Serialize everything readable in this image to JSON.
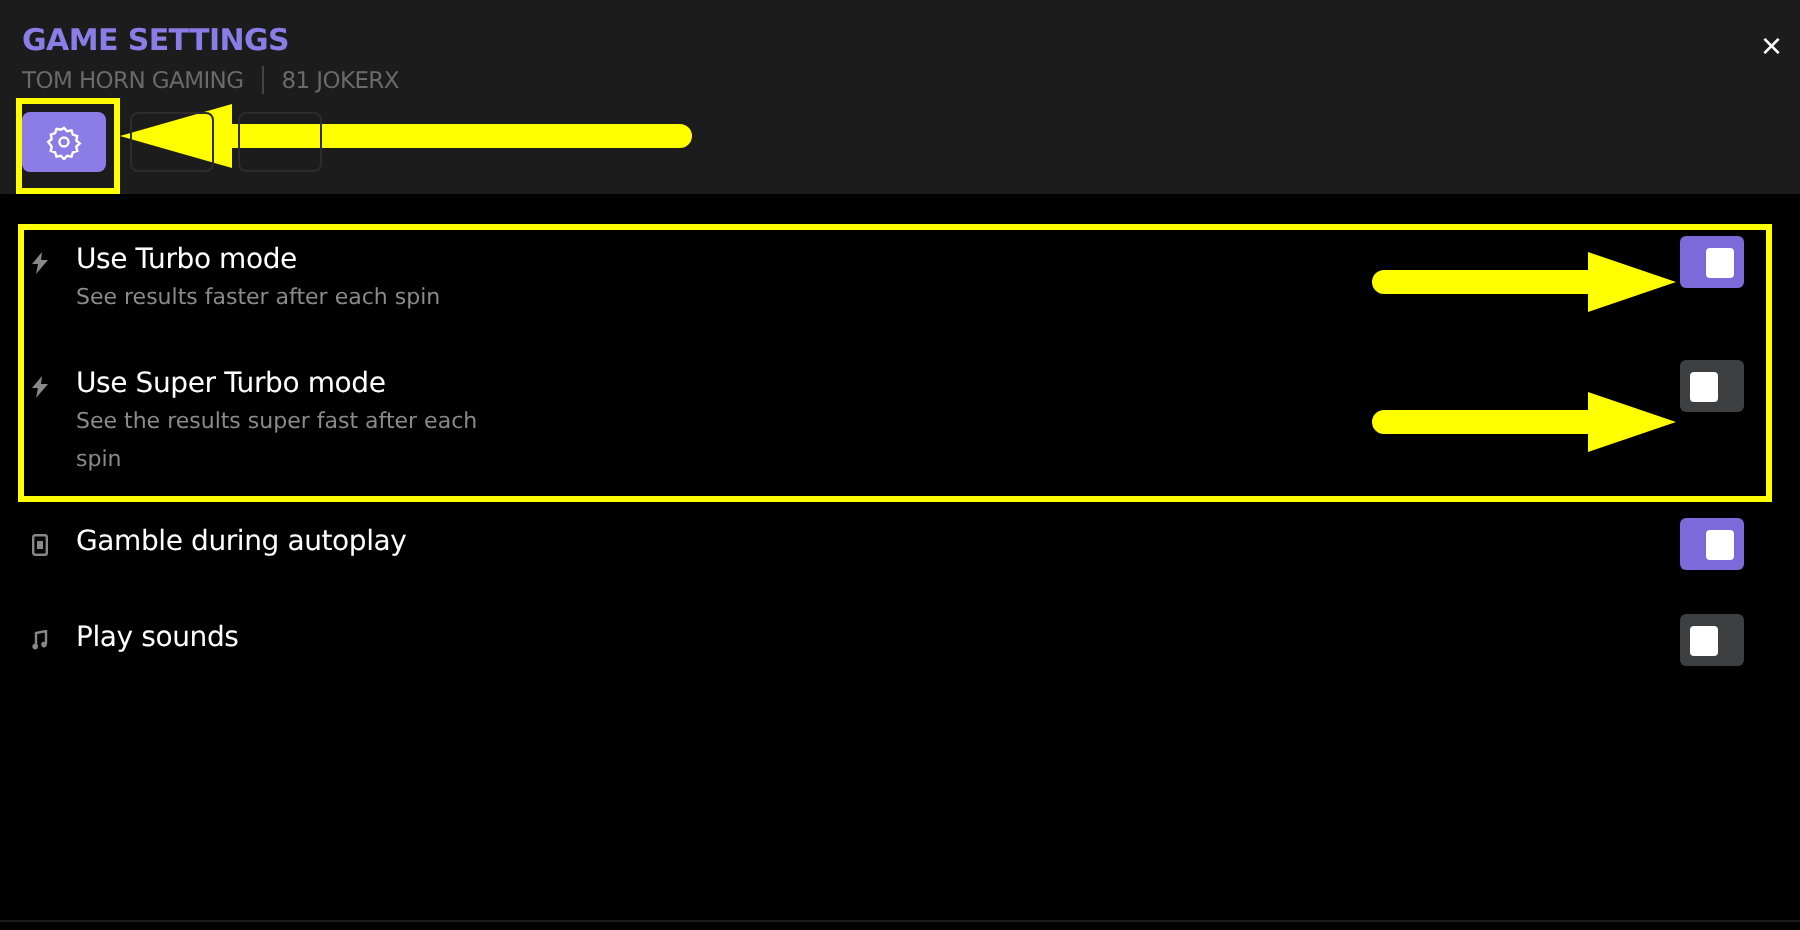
{
  "header": {
    "title": "GAME SETTINGS",
    "provider": "TOM HORN GAMING",
    "game": "81 JOKERX",
    "close": "×"
  },
  "tabs": [
    {
      "kind": "gear",
      "selected": true
    },
    {
      "kind": "blank",
      "selected": false
    },
    {
      "kind": "blank",
      "selected": false
    }
  ],
  "settings": [
    {
      "kind": "bolt",
      "label": "Use Turbo mode",
      "description": "See results faster after each spin",
      "on": true
    },
    {
      "kind": "bolt",
      "label": "Use Super Turbo mode",
      "description": "See the results super fast after each spin",
      "on": false
    },
    {
      "kind": "card",
      "label": "Gamble during autoplay",
      "on": true
    },
    {
      "kind": "note",
      "label": "Play sounds",
      "on": false
    }
  ]
}
